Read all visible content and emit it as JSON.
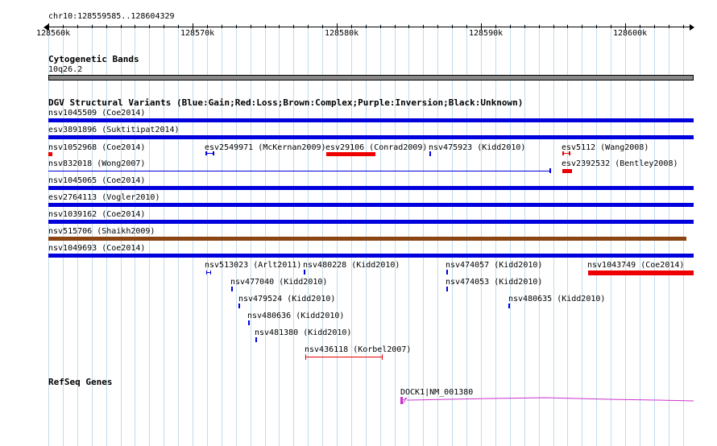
{
  "header": {
    "location": "chr10:128559585..128604329"
  },
  "ruler": {
    "labels": [
      "128560k",
      "128570k",
      "128580k",
      "128590k",
      "128600k"
    ]
  },
  "cytobands": {
    "title": "Cytogenetic Bands",
    "band": "10q26.2"
  },
  "dgv": {
    "title": "DGV Structural Variants (Blue:Gain;Red:Loss;Brown:Complex;Purple:Inversion;Black:Unknown)",
    "colors": {
      "gain": "#0000dd",
      "loss": "#ee0000",
      "complex": "#8b4513"
    },
    "labels": [
      "nsv1045509 (Coe2014)",
      "esv3891896 (Suktitipat2014)",
      "nsv1052968 (Coe2014)",
      "esv2549971 (McKernan2009)",
      "esv29106 (Conrad2009)",
      "nsv475923 (Kidd2010)",
      "esv5112 (Wang2008)",
      "nsv832018 (Wong2007)",
      "esv2392532 (Bentley2008)",
      "nsv1045065 (Coe2014)",
      "esv2764113 (Vogler2010)",
      "nsv1039162 (Coe2014)",
      "nsv515706 (Shaikh2009)",
      "nsv1049693 (Coe2014)",
      "nsv513023 (Arlt2011)",
      "nsv480228 (Kidd2010)",
      "nsv474057 (Kidd2010)",
      "nsv1043749 (Coe2014)",
      "nsv477040 (Kidd2010)",
      "nsv474053 (Kidd2010)",
      "nsv479524 (Kidd2010)",
      "nsv480635 (Kidd2010)",
      "nsv480636 (Kidd2010)",
      "nsv481380 (Kidd2010)",
      "nsv436118 (Korbel2007)"
    ]
  },
  "refseq": {
    "title": "RefSeq Genes",
    "gene": "DOCK1|NM_001380",
    "color": "#cc33cc"
  }
}
